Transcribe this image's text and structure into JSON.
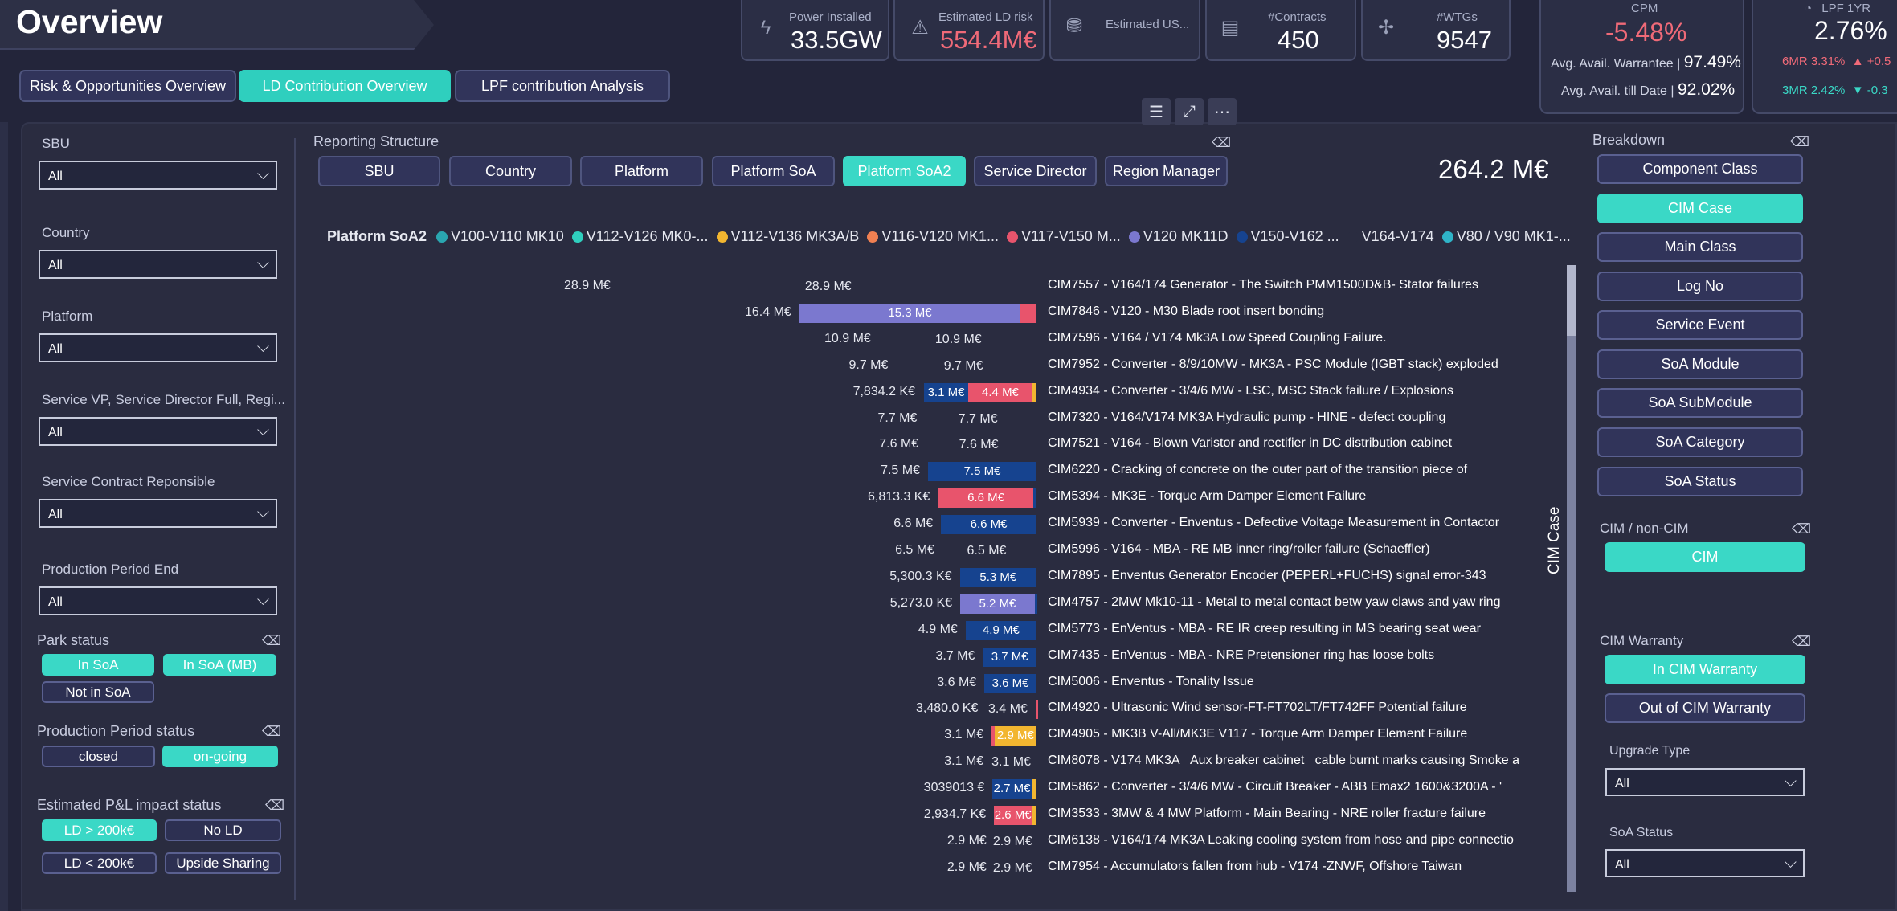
{
  "page_title": "Overview",
  "kpis": [
    {
      "label": "Power Installed",
      "value": "33.5GW",
      "icon": "lightning-icon"
    },
    {
      "label": "Estimated LD risk",
      "value": "554.4M€",
      "icon": "warning-icon"
    },
    {
      "label": "Estimated US...",
      "value": "",
      "icon": "money-icon"
    },
    {
      "label": "#Contracts",
      "value": "450",
      "icon": "document-icon"
    },
    {
      "label": "#WTGs",
      "value": "9547",
      "icon": "wind-turbine-icon"
    }
  ],
  "cpm": {
    "title": "CPM",
    "value": "-5.48%",
    "warrantee_label": "Avg. Avail. Warrantee |",
    "warrantee_value": "97.49%",
    "till_date_label": "Avg. Avail. till Date |",
    "till_date_value": "92.02%"
  },
  "lpf": {
    "title": "LPF 1YR",
    "value": "2.76%",
    "six_mr": "6MR 3.31%",
    "six_mr_delta": "▲ +0.5",
    "three_mr": "3MR 2.42%",
    "three_mr_delta": "▼ -0.3"
  },
  "nav_tabs": [
    {
      "label": "Risk & Opportunities Overview",
      "active": false
    },
    {
      "label": "LD Contribution Overview",
      "active": true
    },
    {
      "label": "LPF contribution Analysis",
      "active": false
    }
  ],
  "toolbar_icons": [
    "filter-icon",
    "focus-mode-icon",
    "more-options-icon"
  ],
  "filters": [
    {
      "label": "SBU",
      "value": "All"
    },
    {
      "label": "Country",
      "value": "All"
    },
    {
      "label": "Platform",
      "value": "All"
    },
    {
      "label": "Service VP, Service Director Full, Regi...",
      "value": "All"
    },
    {
      "label": "Service Contract Reponsible",
      "value": "All"
    },
    {
      "label": "Production Period End",
      "value": "All"
    }
  ],
  "park_status": {
    "label": "Park status",
    "options": [
      {
        "label": "In SoA",
        "on": true
      },
      {
        "label": "In SoA (MB)",
        "on": true
      },
      {
        "label": "Not in SoA",
        "on": false
      }
    ]
  },
  "production_period_status": {
    "label": "Production Period status",
    "options": [
      {
        "label": "closed",
        "on": false
      },
      {
        "label": "on-going",
        "on": true
      }
    ]
  },
  "pl_impact_status": {
    "label": "Estimated P&L impact status",
    "options": [
      {
        "label": "LD > 200k€",
        "on": true
      },
      {
        "label": "No LD",
        "on": false
      },
      {
        "label": "LD < 200k€",
        "on": false
      },
      {
        "label": "Upside Sharing",
        "on": false
      }
    ]
  },
  "reporting_structure": {
    "label": "Reporting Structure",
    "buttons": [
      {
        "label": "SBU",
        "on": false
      },
      {
        "label": "Country",
        "on": false
      },
      {
        "label": "Platform",
        "on": false
      },
      {
        "label": "Platform SoA",
        "on": false
      },
      {
        "label": "Platform SoA2",
        "on": true
      },
      {
        "label": "Service Director",
        "on": false
      },
      {
        "label": "Region Manager",
        "on": false
      }
    ]
  },
  "total_value": "264.2 M€",
  "colors": {
    "accent": "#3ad8c6",
    "V100-V110 MK10": "#2aa6b0",
    "V112-V126 MK0-...": "#2fcfbe",
    "V112-V136 MK3A/B": "#f2b630",
    "V116-V120 MK1...": "#f08052",
    "V117-V150 M...": "#e8546c",
    "V120 MK11D": "#7b78cf",
    "V150-V162 ...": "#16438f",
    "V164-V174": "#2a2c40",
    "V80 / V90 MK1-...": "#2fb4c8"
  },
  "chart_data": {
    "type": "bar",
    "orientation": "horizontal",
    "stacked": true,
    "legend_title": "Platform SoA2",
    "legend_position": "top",
    "axis_title": "CIM Case",
    "series": [
      {
        "name": "V100-V110 MK10"
      },
      {
        "name": "V112-V126 MK0-..."
      },
      {
        "name": "V112-V136 MK3A/B"
      },
      {
        "name": "V116-V120 MK1..."
      },
      {
        "name": "V117-V150 M..."
      },
      {
        "name": "V120 MK11D"
      },
      {
        "name": "V150-V162 ..."
      },
      {
        "name": "V164-V174"
      },
      {
        "name": "V80 / V90 MK1-..."
      }
    ],
    "rows": [
      {
        "category": "CIM7557 - V164/174 Generator - The Switch PMM1500D&B- Stator failures",
        "total_label": "28.9 M€",
        "total": 28.9,
        "segments": [
          {
            "series": "V164-V174",
            "value": 28.9,
            "label": "28.9 M€"
          }
        ]
      },
      {
        "category": "CIM7846 - V120 - M30 Blade root insert bonding",
        "total_label": "16.4 M€",
        "total": 16.4,
        "segments": [
          {
            "series": "V120 MK11D",
            "value": 15.3,
            "label": "15.3 M€"
          },
          {
            "series": "V117-V150 M...",
            "value": 1.1,
            "label": ""
          }
        ]
      },
      {
        "category": "CIM7596 - V164 / V174 Mk3A Low Speed Coupling Failure.",
        "total_label": "10.9 M€",
        "total": 10.9,
        "segments": [
          {
            "series": "V164-V174",
            "value": 10.9,
            "label": "10.9 M€"
          }
        ]
      },
      {
        "category": "CIM7952 - Converter - 8/9/10MW - MK3A - PSC Module (IGBT stack) exploded",
        "total_label": "9.7 M€",
        "total": 9.7,
        "segments": [
          {
            "series": "V164-V174",
            "value": 9.7,
            "label": "9.7 M€"
          }
        ]
      },
      {
        "category": "CIM4934 - Converter - 3/4/6 MW - LSC, MSC Stack failure / Explosions",
        "total_label": "7,834.2 K€",
        "total": 7.8342,
        "segments": [
          {
            "series": "V150-V162 ...",
            "value": 3.1,
            "label": "3.1 M€"
          },
          {
            "series": "V117-V150 M...",
            "value": 4.4,
            "label": "4.4 M€"
          },
          {
            "series": "V112-V136 MK3A/B",
            "value": 0.3,
            "label": ""
          }
        ]
      },
      {
        "category": "CIM7320 - V164/V174 MK3A Hydraulic pump - HINE - defect coupling",
        "total_label": "7.7 M€",
        "total": 7.7,
        "segments": [
          {
            "series": "V164-V174",
            "value": 7.7,
            "label": "7.7 M€"
          }
        ]
      },
      {
        "category": "CIM7521 - V164 - Blown Varistor and rectifier in DC distribution cabinet",
        "total_label": "7.6 M€",
        "total": 7.6,
        "segments": [
          {
            "series": "V164-V174",
            "value": 7.6,
            "label": "7.6 M€"
          }
        ]
      },
      {
        "category": "CIM6220 - Cracking of concrete on the outer part of the transition piece of",
        "total_label": "7.5 M€",
        "total": 7.5,
        "segments": [
          {
            "series": "V150-V162 ...",
            "value": 7.5,
            "label": "7.5 M€"
          }
        ]
      },
      {
        "category": "CIM5394 - MK3E - Torque Arm Damper Element Failure",
        "total_label": "6,813.3 K€",
        "total": 6.8133,
        "segments": [
          {
            "series": "V117-V150 M...",
            "value": 6.6,
            "label": "6.6 M€"
          },
          {
            "series": "V150-V162 ...",
            "value": 0.2,
            "label": ""
          }
        ]
      },
      {
        "category": "CIM5939 - Converter - Enventus - Defective Voltage Measurement in Contactor",
        "total_label": "6.6 M€",
        "total": 6.6,
        "segments": [
          {
            "series": "V150-V162 ...",
            "value": 6.6,
            "label": "6.6 M€"
          }
        ]
      },
      {
        "category": "CIM5996 - V164 - MBA - RE MB inner ring/roller failure (Schaeffler)",
        "total_label": "6.5 M€",
        "total": 6.5,
        "segments": [
          {
            "series": "V164-V174",
            "value": 6.5,
            "label": "6.5 M€"
          }
        ]
      },
      {
        "category": "CIM7895 - Enventus Generator Encoder (PEPERL+FUCHS) signal error-343",
        "total_label": "5,300.3 K€",
        "total": 5.3003,
        "segments": [
          {
            "series": "V150-V162 ...",
            "value": 5.3,
            "label": "5.3 M€"
          }
        ]
      },
      {
        "category": "CIM4757 - 2MW Mk10-11 - Metal to metal contact betw yaw claws and yaw ring",
        "total_label": "5,273.0 K€",
        "total": 5.273,
        "segments": [
          {
            "series": "V120 MK11D",
            "value": 5.2,
            "label": "5.2 M€"
          },
          {
            "series": "V150-V162 ...",
            "value": 0.1,
            "label": ""
          }
        ]
      },
      {
        "category": "CIM5773 - EnVentus - MBA - RE IR creep resulting in MS bearing seat wear",
        "total_label": "4.9 M€",
        "total": 4.9,
        "segments": [
          {
            "series": "V150-V162 ...",
            "value": 4.9,
            "label": "4.9 M€"
          }
        ]
      },
      {
        "category": "CIM7435 - EnVentus - MBA - NRE Pretensioner ring has loose bolts",
        "total_label": "3.7 M€",
        "total": 3.7,
        "segments": [
          {
            "series": "V150-V162 ...",
            "value": 3.7,
            "label": "3.7 M€"
          }
        ]
      },
      {
        "category": "CIM5006 - Enventus - Tonality Issue",
        "total_label": "3.6 M€",
        "total": 3.6,
        "segments": [
          {
            "series": "V150-V162 ...",
            "value": 3.6,
            "label": "3.6 M€"
          }
        ]
      },
      {
        "category": "CIM4920 - Ultrasonic Wind sensor-FT-FT702LT/FT742FF Potential failure",
        "total_label": "3,480.0 K€",
        "total": 3.48,
        "segments": [
          {
            "series": "V164-V174",
            "value": 3.4,
            "label": "3.4 M€"
          },
          {
            "series": "V117-V150 M...",
            "value": 0.08,
            "label": ""
          }
        ]
      },
      {
        "category": "CIM4905 - MK3B V-All/MK3E V117 - Torque Arm Damper Element Failure",
        "total_label": "3.1 M€",
        "total": 3.1,
        "segments": [
          {
            "series": "V117-V150 M...",
            "value": 0.2,
            "label": ""
          },
          {
            "series": "V112-V136 MK3A/B",
            "value": 2.9,
            "label": "2.9 M€"
          }
        ]
      },
      {
        "category": "CIM8078 - V174 MK3A _Aux breaker cabinet _cable burnt marks causing Smoke a",
        "total_label": "3.1 M€",
        "total": 3.1,
        "segments": [
          {
            "series": "V164-V174",
            "value": 3.1,
            "label": "3.1 M€"
          }
        ]
      },
      {
        "category": "CIM5862 - Converter - 3/4/6 MW - Circuit Breaker - ABB Emax2 1600&3200A - '",
        "total_label": "3039013 €",
        "total": 3.039,
        "segments": [
          {
            "series": "V150-V162 ...",
            "value": 2.7,
            "label": "2.7 M€"
          },
          {
            "series": "V112-V136 MK3A/B",
            "value": 0.34,
            "label": ""
          }
        ]
      },
      {
        "category": "CIM3533 - 3MW & 4 MW Platform - Main Bearing - NRE roller fracture failure",
        "total_label": "2,934.7 K€",
        "total": 2.9347,
        "segments": [
          {
            "series": "V117-V150 M...",
            "value": 2.6,
            "label": "2.6 M€"
          },
          {
            "series": "V112-V136 MK3A/B",
            "value": 0.33,
            "label": ""
          }
        ]
      },
      {
        "category": "CIM6138 - V164/174 MK3A Leaking cooling system from hose and pipe connectio",
        "total_label": "2.9 M€",
        "total": 2.9,
        "segments": [
          {
            "series": "V164-V174",
            "value": 2.9,
            "label": "2.9 M€"
          }
        ]
      },
      {
        "category": "CIM7954 - Accumulators fallen from hub - V174 -ZNWF, Offshore Taiwan",
        "total_label": "2.9 M€",
        "total": 2.9,
        "segments": [
          {
            "series": "V164-V174",
            "value": 2.9,
            "label": "2.9 M€"
          }
        ]
      }
    ]
  },
  "breakdown": {
    "label": "Breakdown",
    "buttons": [
      {
        "label": "Component Class",
        "on": false
      },
      {
        "label": "CIM Case",
        "on": true
      },
      {
        "label": "Main Class",
        "on": false
      },
      {
        "label": "Log No",
        "on": false
      },
      {
        "label": "Service Event",
        "on": false
      },
      {
        "label": "SoA Module",
        "on": false
      },
      {
        "label": "SoA SubModule",
        "on": false
      },
      {
        "label": "SoA Category",
        "on": false
      },
      {
        "label": "SoA Status",
        "on": false
      }
    ]
  },
  "cim_noncim": {
    "label": "CIM / non-CIM",
    "options": [
      {
        "label": "CIM",
        "on": true
      }
    ]
  },
  "cim_warranty": {
    "label": "CIM Warranty",
    "options": [
      {
        "label": "In CIM Warranty",
        "on": true
      },
      {
        "label": "Out of CIM Warranty",
        "on": false
      }
    ]
  },
  "upgrade_type": {
    "label": "Upgrade Type",
    "value": "All"
  },
  "soa_status": {
    "label": "SoA Status",
    "value": "All"
  }
}
